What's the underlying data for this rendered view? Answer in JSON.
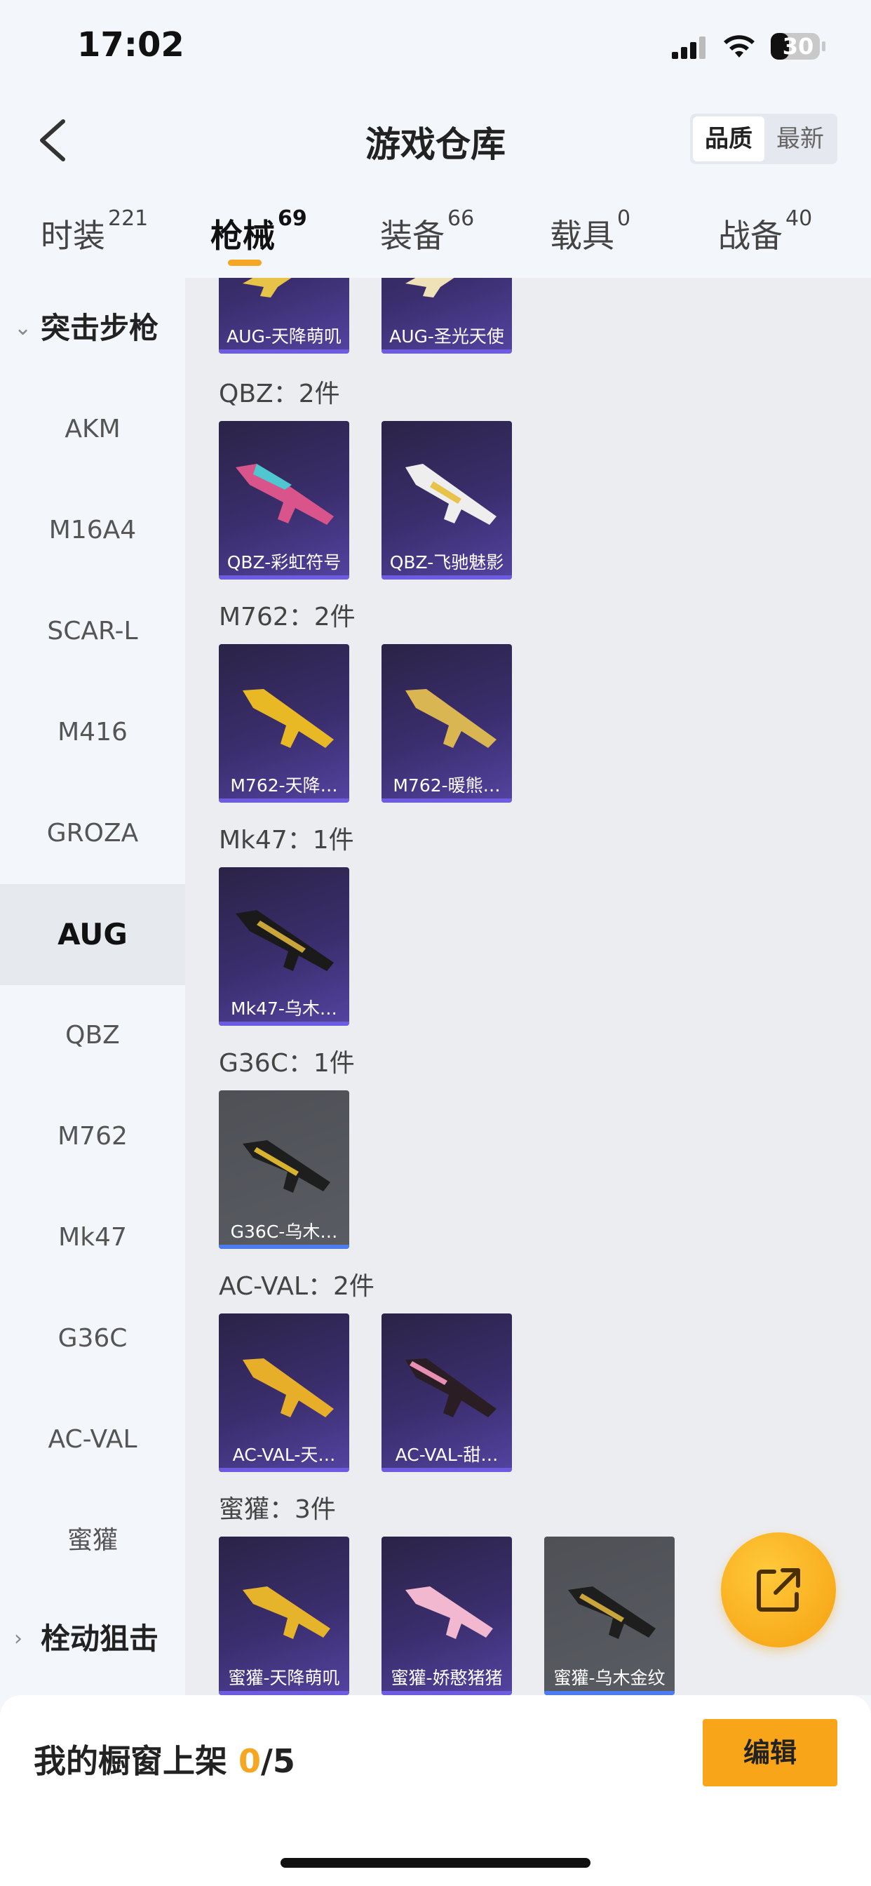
{
  "status": {
    "time": "17:02",
    "battery": "30"
  },
  "header": {
    "title": "游戏仓库",
    "sort_options": [
      "品质",
      "最新"
    ],
    "sort_active": "品质"
  },
  "tabs": [
    {
      "label": "时装",
      "count": "221"
    },
    {
      "label": "枪械",
      "count": "69"
    },
    {
      "label": "装备",
      "count": "66"
    },
    {
      "label": "载具",
      "count": "0"
    },
    {
      "label": "战备",
      "count": "40"
    }
  ],
  "sidebar": {
    "group_open": "突击步枪",
    "items": [
      "AKM",
      "M16A4",
      "SCAR-L",
      "M416",
      "GROZA",
      "AUG",
      "QBZ",
      "M762",
      "Mk47",
      "G36C",
      "AC-VAL",
      "蜜獾"
    ],
    "active": "AUG",
    "group_collapsed": "栓动狙击"
  },
  "content": {
    "top_cards": [
      "AUG-天降萌叽",
      "AUG-圣光天使"
    ],
    "groups": [
      {
        "label": "QBZ：2件",
        "cards": [
          "QBZ-彩虹符号",
          "QBZ-飞驰魅影"
        ]
      },
      {
        "label": "M762：2件",
        "cards": [
          "M762-天降…",
          "M762-暖熊…"
        ]
      },
      {
        "label": "Mk47：1件",
        "cards": [
          "Mk47-乌木…"
        ]
      },
      {
        "label": "G36C：1件",
        "cards": [
          "G36C-乌木…"
        ]
      },
      {
        "label": "AC-VAL：2件",
        "cards": [
          "AC-VAL-天…",
          "AC-VAL-甜…"
        ]
      },
      {
        "label": "蜜獾：3件",
        "cards": [
          "蜜獾-天降萌叽",
          "蜜獾-娇憨猪猪",
          "蜜獾-乌木金纹"
        ]
      }
    ]
  },
  "bottom": {
    "shelf_label": "我的橱窗上架",
    "shelf_current": "0",
    "shelf_total": "/5",
    "edit_label": "编辑"
  },
  "colors": {
    "accent": "#f5a623",
    "card_purple": "#3b2e6e",
    "card_grey": "#55575d"
  }
}
